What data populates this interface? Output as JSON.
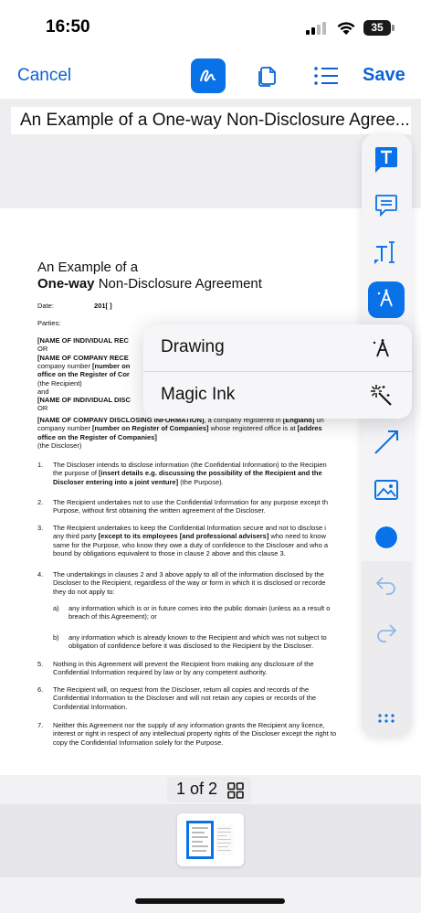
{
  "status_bar": {
    "time": "16:50",
    "battery": "35"
  },
  "toolbar": {
    "cancel_label": "Cancel",
    "save_label": "Save",
    "accent_color": "#0a72e8",
    "tools": [
      "markup-pen-icon",
      "duplicate-pages-icon",
      "list-icon"
    ]
  },
  "document": {
    "title": "An Example of a One-way Non-Disclosure Agree...",
    "heading_line1": "An Example of a",
    "heading_bold": "One-way",
    "heading_rest": " Non-Disclosure Agreement",
    "date_label": "Date:",
    "date_value": "201[ ]",
    "parties_label": "Parties:",
    "party_lines": [
      "[NAME OF INDIVIDUAL REC",
      "OR",
      "[NAME OF COMPANY RECE",
      "company number [number on",
      "office on the Register of Cor",
      "(the Recipient)",
      "and",
      "[NAME OF INDIVIDUAL DISC",
      "OR"
    ],
    "discloser_line1_bold": "[NAME OF COMPANY DISCLOSING INFORMATION]",
    "discloser_line1_rest": ", a company registered in ",
    "discloser_line1_bold2": "[England]",
    "discloser_line1_tail": " un",
    "discloser_line2_pre": "company number ",
    "discloser_line2_bold": "[number on Register of Companies]",
    "discloser_line2_rest": " whose registered office is at ",
    "discloser_line2_bold2": "[addres",
    "discloser_line3_bold": "office on the Register of Companies]",
    "discloser_line4": "(the Discloser)",
    "clauses": [
      {
        "num": "1.",
        "lines": [
          "The Discloser intends to disclose information (the Confidential Information) to the Recipien",
          "the purpose of [insert details e.g. discussing the possibility of the Recipient and the",
          "Discloser entering into a joint venture] (the Purpose)."
        ]
      },
      {
        "num": "2.",
        "lines": [
          "The Recipient undertakes not to use the Confidential Information for any purpose except th",
          "Purpose, without first obtaining the written agreement of the Discloser."
        ]
      },
      {
        "num": "3.",
        "lines": [
          "The Recipient undertakes to keep the Confidential Information secure and not to disclose i",
          "any third party [except to its employees [and professional advisers] who need to know",
          "same for the Purpose, who know they owe a duty of confidence to the Discloser and who a",
          "bound by obligations equivalent to those in clause 2 above and this clause 3."
        ]
      },
      {
        "num": "4.",
        "lines": [
          "The undertakings in clauses 2 and 3 above apply to all of the information disclosed by the",
          "Discloser to the Recipient, regardless of the way or form in which it is disclosed or recorde",
          "they do not apply to:"
        ]
      },
      {
        "num": "5.",
        "lines": [
          "Nothing in this Agreement will prevent the Recipient from making any disclosure of the",
          "Confidential Information required by law or by any competent authority."
        ]
      },
      {
        "num": "6.",
        "lines": [
          "The Recipient will, on request from the Discloser, return all copies and records of the",
          "Confidential Information to the Discloser and will not retain any copies or records of the",
          "Confidential Information."
        ]
      },
      {
        "num": "7.",
        "lines": [
          "Neither this Agreement nor the supply of any information grants the Recipient any licence,",
          "interest or right in respect of any intellectual property rights of the Discloser except the right to",
          "copy the Confidential Information solely for the Purpose."
        ]
      }
    ],
    "subclauses": [
      {
        "num": "a)",
        "lines": [
          "any information which is or in future comes into the public domain (unless as a result o",
          "breach of this Agreement); or"
        ]
      },
      {
        "num": "b)",
        "lines": [
          "any information which is already known to the Recipient and which was not subject to",
          "obligation of confidence before it was disclosed to the Recipient by the Discloser."
        ]
      }
    ]
  },
  "pagination": {
    "current": "1",
    "of_label": "of",
    "total": "2",
    "text": "1 of 2"
  },
  "popup_menu": {
    "items": [
      {
        "label": "Drawing",
        "icon": "pen-nib-icon"
      },
      {
        "label": "Magic Ink",
        "icon": "magic-wand-icon"
      }
    ]
  },
  "side_toolbar": {
    "tools": [
      "text-box-icon",
      "comment-icon",
      "text-cursor-icon",
      "pen-nib-icon",
      "line-arrow-icon",
      "image-icon",
      "color-picker-icon",
      "undo-icon",
      "redo-icon",
      "more-icon"
    ],
    "selected_color": "#0a72e8"
  }
}
